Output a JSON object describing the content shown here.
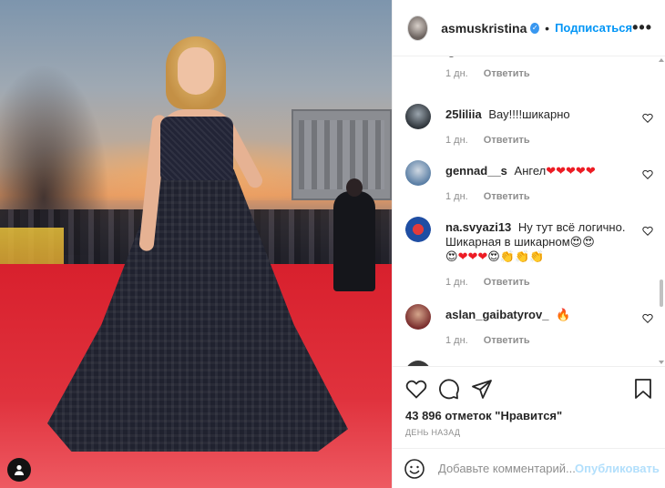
{
  "header": {
    "username": "asmuskristina",
    "verified_symbol": "✓",
    "separator": "•",
    "follow_label": "Подписаться",
    "more_label": "•••"
  },
  "comments": [
    {
      "user": "",
      "text": "😂",
      "time": "1 дн.",
      "reply_label": "Ответить",
      "avatar_color": "#c94a4a"
    },
    {
      "user": "25liliia",
      "text": "Вау!!!!шикарно",
      "time": "1 дн.",
      "reply_label": "Ответить",
      "avatar_color": "#4a4f55"
    },
    {
      "user": "gennad__s",
      "text_prefix": "Ангел",
      "text_suffix": "❤❤❤❤❤",
      "time": "1 дн.",
      "reply_label": "Ответить",
      "avatar_color": "#6d8fb0"
    },
    {
      "user": "na.svyazi13",
      "text_line1": "Ну тут всё логично.",
      "text_line2": "Шикарная в шикарном😍😍",
      "text_line3_a": "😍",
      "text_line3_b": "❤❤❤",
      "text_line3_c": "😍👏👏👏",
      "time": "1 дн.",
      "reply_label": "Ответить",
      "avatar_color": "#2a5bb5"
    },
    {
      "user": "aslan_gaibatyrov_",
      "text": "🔥",
      "time": "1 дн.",
      "reply_label": "Ответить",
      "avatar_color": "#a03a3a"
    }
  ],
  "actions": {
    "icons": [
      "heart-icon",
      "comment-icon",
      "share-icon",
      "bookmark-icon"
    ],
    "likes_text": "43 896 отметок \"Нравится\"",
    "date_text": "ДЕНЬ НАЗАД"
  },
  "add_comment": {
    "placeholder": "Добавьте комментарий...",
    "post_label": "Опубликовать"
  },
  "colors": {
    "accent": "#0095f6",
    "post_disabled": "#b2dffc",
    "meta_gray": "#8e8e8e",
    "heart_red": "#ed1c24"
  }
}
